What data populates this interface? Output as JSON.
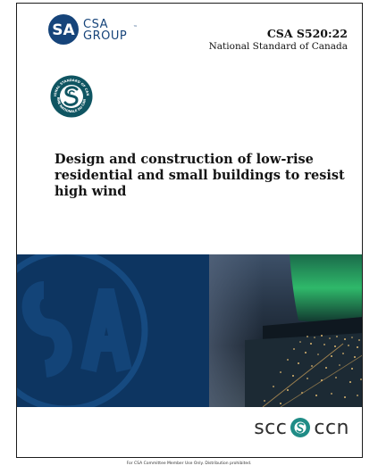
{
  "publisher": {
    "logo_line1": "CSA",
    "logo_line2": "GROUP",
    "logo_trademark": "™",
    "brand_color": "#16447a"
  },
  "standard": {
    "number": "CSA S520:22",
    "subtitle": "National Standard of Canada"
  },
  "seal": {
    "icon": "national-standard-of-canada-seal-icon",
    "text_top": "NATIONAL STANDARD OF CANADA",
    "text_bottom": "NORME NATIONALE DU CANADA",
    "color": "#0f5562"
  },
  "title": "Design and construction of low-rise residential and small buildings to resist high wind",
  "cover_image": {
    "band_color": "#0d3561",
    "aurora_color": "#2fb86a"
  },
  "scc_logo": {
    "left": "scc",
    "right": "ccn",
    "mark_color": "#1f8c86"
  },
  "footer": {
    "note": "For CSA Committee Member Use Only.  Distribution prohibited."
  }
}
